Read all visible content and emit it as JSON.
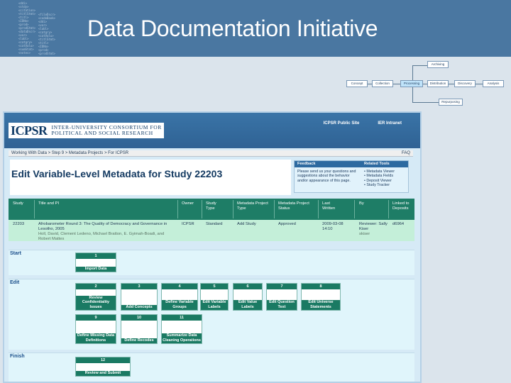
{
  "slide": {
    "title": "Data Documentation Initiative",
    "texture": [
      "<ddi>",
      "<stdy>",
      "<citation>",
      "<titlStmt>",
      "<titl>",
      "<IDNo>",
      "<prod>",
      "<prodStmt>",
      "<dataDscr>",
      "<var>",
      "<labl>",
      "<catgry>",
      "<catValu>",
      "<sumStat>",
      "<notes>",
      "<fileDscr>",
      "<codeBook>"
    ]
  },
  "lifecycle": {
    "nodes": [
      "Archiving",
      "Concept",
      "Collection",
      "Processing",
      "Distribution",
      "Discovery",
      "Analysis",
      "Repurposing"
    ],
    "active": "Processing"
  },
  "app": {
    "logo": "ICPSR",
    "org_line1": "INTER-UNIVERSITY CONSORTIUM FOR",
    "org_line2": "POLITICAL AND SOCIAL RESEARCH",
    "links": [
      "ICPSR Public Site",
      "IER Intranet"
    ],
    "breadcrumb": "Working With Data > Step 9 > Metadata Projects > For ICPSR",
    "faq": "FAQ",
    "page_title": "Edit Variable-Level Metadata for Study",
    "study_number": "22203",
    "feedback": {
      "heading": "Feedback",
      "text": "Please send us your questions and suggestions about the behavior and/or appearance of this page."
    },
    "related": {
      "heading": "Related Tools",
      "items": [
        "• Metadata Viewer",
        "• Metadata Fields",
        "• Deposit Viewer",
        "• Study Tracker"
      ]
    }
  },
  "table": {
    "headers": [
      "Study",
      "Title and PI",
      "Owner",
      "Study Type",
      "Metadata Project Type",
      "Metadata Project Status",
      "Last Written",
      "By",
      "Linked to Deposits"
    ],
    "row": {
      "study": "22203",
      "title": "Afrobarometer Round 3: The Quality of Democracy and Governance in Lesotho, 2005",
      "pi": "Holl, David, Clement Ledeno, Michael Bratton, E. Gyimah-Boadi, and Robert Mattes",
      "owner": "ICPSR",
      "study_type": "Standard",
      "project_type": "Add Study",
      "status": "Approved",
      "date": "2009-03-08",
      "time": "14:10",
      "by": "Reviewer: Sally Kiser",
      "by_id": "skiser",
      "linked": "d6964"
    }
  },
  "sections": {
    "start": "Start",
    "edit": "Edit",
    "finish": "Finish"
  },
  "steps": {
    "import": {
      "num": "1",
      "label": "Import Data"
    },
    "review": {
      "num": "2",
      "label": "Review Confidentiality Issues"
    },
    "concepts": {
      "num": "3",
      "label": "Add Concepts"
    },
    "groups": {
      "num": "4",
      "label": "Define Variable Groups"
    },
    "varlabels": {
      "num": "5",
      "label": "Edit Variable Labels"
    },
    "vallabels": {
      "num": "6",
      "label": "Edit Value Labels"
    },
    "qtext": {
      "num": "7",
      "label": "Edit Question Text"
    },
    "universe": {
      "num": "8",
      "label": "Edit Universe Statements"
    },
    "missing": {
      "num": "9",
      "label": "Define Missing Data Definitions"
    },
    "recodes": {
      "num": "10",
      "label": "Define Recodes"
    },
    "cleaning": {
      "num": "11",
      "label": "Summarize Data Cleaning Operations"
    },
    "submit": {
      "num": "12",
      "label": "Review and Submit"
    }
  }
}
